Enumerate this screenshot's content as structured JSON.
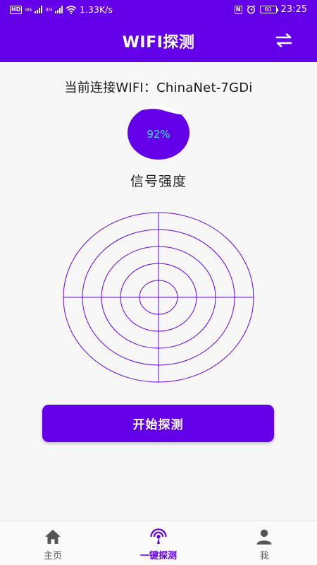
{
  "status_bar": {
    "hd_badge": "HD",
    "net_gen_1": "4G",
    "net_gen_2": "3G",
    "net_speed": "1.33K/s",
    "nfc_badge": "N",
    "battery": "60",
    "time": "23:25"
  },
  "header": {
    "title": "WIFI探测"
  },
  "wifi": {
    "connection_text": "当前连接WIFI：ChinaNet-7GDi"
  },
  "signal": {
    "percent_text": "92%",
    "fraction": 0.92,
    "label": "信号强度"
  },
  "actions": {
    "start_label": "开始探测"
  },
  "nav": {
    "items": [
      {
        "label": "主页",
        "icon": "home-icon"
      },
      {
        "label": "一键探测",
        "icon": "radar-signal-icon"
      },
      {
        "label": "我",
        "icon": "person-icon"
      }
    ],
    "active_index": 1
  },
  "colors": {
    "primary": "#6300e9",
    "percent_text": "#45e0ff",
    "radar_line": "#6300e9",
    "inactive_icon": "#555555",
    "background": "#f7f7f7"
  }
}
